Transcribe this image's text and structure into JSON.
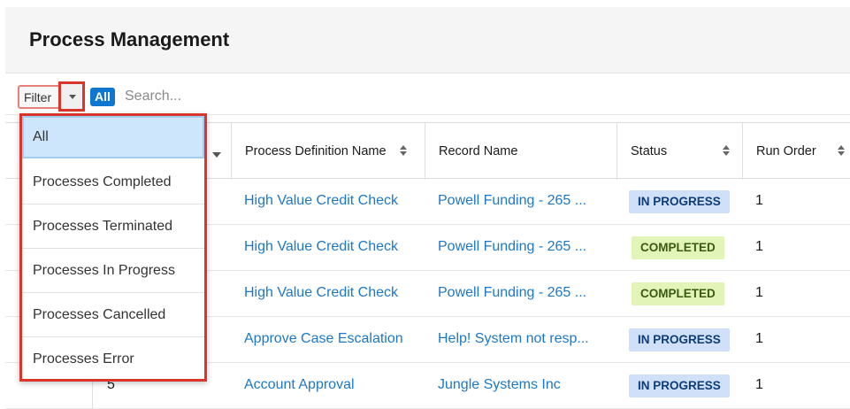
{
  "page": {
    "title": "Process Management"
  },
  "filter": {
    "label": "Filter",
    "active_filter": "All",
    "search_placeholder": "Search..."
  },
  "dropdown": {
    "items": [
      {
        "label": "All",
        "selected": true
      },
      {
        "label": "Processes Completed"
      },
      {
        "label": "Processes Terminated"
      },
      {
        "label": "Processes In Progress"
      },
      {
        "label": "Processes Cancelled"
      },
      {
        "label": "Processes Error"
      }
    ]
  },
  "table": {
    "columns": [
      "Process Definition Name",
      "Record Name",
      "Status",
      "Run Order"
    ],
    "rows": [
      {
        "id": "",
        "definition": "High Value Credit Check",
        "record": "Powell Funding - 265 ...",
        "status": "IN PROGRESS",
        "status_type": "progress",
        "run_order": "1"
      },
      {
        "id": "",
        "definition": "High Value Credit Check",
        "record": "Powell Funding - 265 ...",
        "status": "COMPLETED",
        "status_type": "completed",
        "run_order": "1"
      },
      {
        "id": "",
        "definition": "High Value Credit Check",
        "record": "Powell Funding - 265 ...",
        "status": "COMPLETED",
        "status_type": "completed",
        "run_order": "1"
      },
      {
        "id": "",
        "definition": "Approve Case Escalation",
        "record": "Help! System not resp...",
        "status": "IN PROGRESS",
        "status_type": "progress",
        "run_order": "1"
      },
      {
        "id": "5",
        "definition": "Account Approval",
        "record": "Jungle Systems Inc",
        "status": "IN PROGRESS",
        "status_type": "progress",
        "run_order": "1"
      }
    ]
  },
  "colors": {
    "link": "#1c78c7",
    "highlight": "#d9352b",
    "pill": "#0f77cf",
    "badge_progress_bg": "#cfe0f8",
    "badge_completed_bg": "#e3f4b8"
  }
}
